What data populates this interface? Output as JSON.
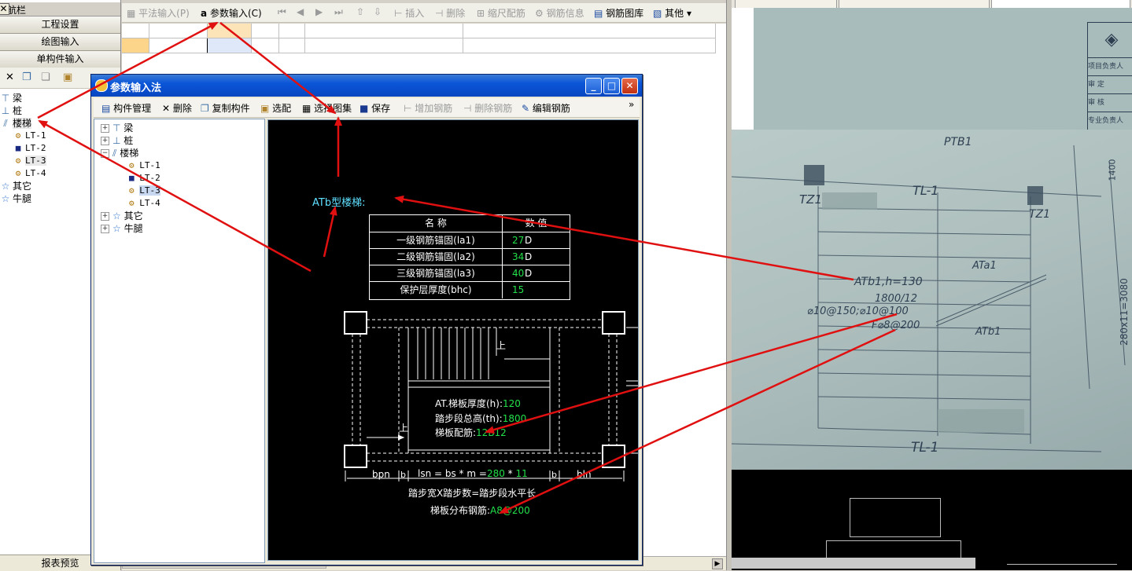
{
  "nav": {
    "title": "导航栏",
    "pin": "ᵖ",
    "close": "✕",
    "buttons": [
      "工程设置",
      "绘图输入",
      "单构件输入"
    ],
    "tree": [
      {
        "label": "梁",
        "icon": "beam-icon"
      },
      {
        "label": "桩",
        "icon": "pile-icon"
      },
      {
        "label": "楼梯",
        "icon": "stair-icon"
      },
      {
        "label": "LT-1",
        "icon": "gear-icon"
      },
      {
        "label": "LT-2",
        "icon": "lock-icon"
      },
      {
        "label": "LT-3",
        "icon": "gear-icon"
      },
      {
        "label": "LT-4",
        "icon": "gear-icon"
      },
      {
        "label": "其它",
        "icon": "star-icon"
      },
      {
        "label": "牛腿",
        "icon": "star-icon"
      }
    ],
    "report": "报表预览"
  },
  "main_toolbar": {
    "flat_input": "平法输入(P)",
    "param_input": "参数输入(C)",
    "insert": "插入",
    "delete": "删除",
    "scale": "缩尺配筋",
    "rebar_info": "钢筋信息",
    "rebar_lib": "钢筋图库",
    "other": "其他"
  },
  "dialog": {
    "title": "参数输入法",
    "toolbar": {
      "manage": "构件管理",
      "delete": "删除",
      "copy": "复制构件",
      "select": "选配",
      "choose_atlas": "选择图集",
      "save": "保存",
      "add_rebar": "增加钢筋",
      "remove_rebar": "删除钢筋",
      "edit_rebar": "编辑钢筋",
      "more": "»"
    },
    "tree": [
      {
        "label": "梁",
        "icon": "beam-icon"
      },
      {
        "label": "桩",
        "icon": "pile-icon"
      },
      {
        "label": "楼梯",
        "icon": "stair-icon"
      },
      {
        "label": "LT-1",
        "icon": "gear-icon"
      },
      {
        "label": "LT-2",
        "icon": "lock-icon"
      },
      {
        "label": "LT-3",
        "icon": "gear-icon"
      },
      {
        "label": "LT-4",
        "icon": "gear-icon"
      },
      {
        "label": "其它",
        "icon": "star-icon"
      },
      {
        "label": "牛腿",
        "icon": "star-icon"
      }
    ],
    "canvas": {
      "stair_type": "ATb型楼梯:",
      "table_headers": [
        "名 称",
        "数 值"
      ],
      "table_rows": [
        {
          "name": "一级钢筋锚固(la1)",
          "value": "27",
          "unit": "D"
        },
        {
          "name": "二级钢筋锚固(la2)",
          "value": "34",
          "unit": "D"
        },
        {
          "name": "三级钢筋锚固(la3)",
          "value": "40",
          "unit": "D"
        },
        {
          "name": "保护层厚度(bhc)",
          "value": "15",
          "unit": ""
        }
      ],
      "up_label": "上",
      "thickness_label": "AT.梯板厚度(h):",
      "thickness_value": "120",
      "height_label": "踏步段总高(th):",
      "height_value": "1800",
      "rebar_label": "梯板配筋:",
      "rebar_value": "12B12",
      "bpn": "bpn",
      "b": "b",
      "lsn_formula": "lsn = bs * m =",
      "bs_value": "280",
      "times": "*",
      "m_value": "11",
      "bln": "bln",
      "step_formula": "踏步宽X踏步数=踏步段水平长",
      "dist_label": "梯板分布钢筋:",
      "dist_value": "A8@200"
    }
  },
  "photo": {
    "labels": [
      "PTB1",
      "TL-1",
      "TZ1",
      "TZ1",
      "ATb1,h=130",
      "1800/12",
      "⌀10@150;⌀10@100",
      "F⌀8@200",
      "ATa1",
      "ATb1",
      "TL-1",
      "1400",
      "280x11=3080"
    ],
    "stamp_rows": [
      "项目负责人",
      "审  定",
      "审  核",
      "专业负责人"
    ]
  },
  "colors": {
    "annotation_arrow": "#e01010",
    "cad_green": "#22e04a",
    "cad_cyan": "#5ee0ff",
    "cad_white": "#ffffff",
    "titlebar": "#0a55d8"
  }
}
